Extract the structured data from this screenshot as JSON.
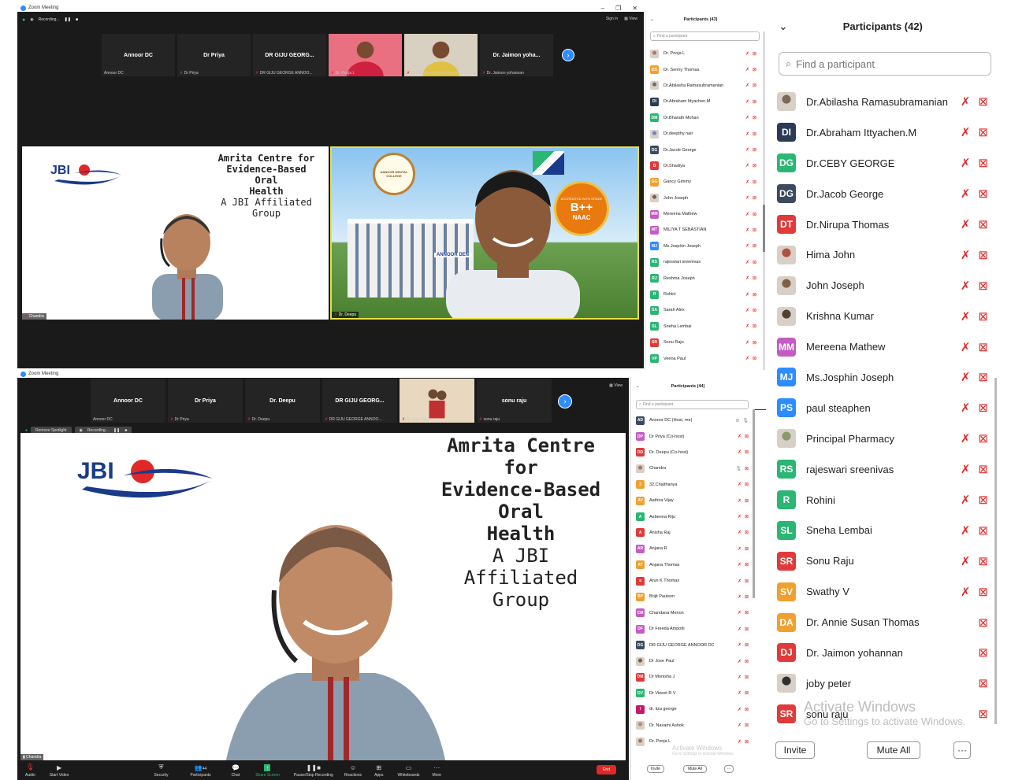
{
  "top_window": {
    "title": "Zoom Meeting",
    "recording": "Recording...",
    "sign_in": "Sign in",
    "view": "View",
    "strip": [
      {
        "name": "Annoor DC",
        "sub": "Annoor DC",
        "type": "name"
      },
      {
        "name": "Dr Priya",
        "sub": "Dr Priya",
        "type": "name"
      },
      {
        "name": "DR GIJU GEORG...",
        "sub": "DR GIJU GEORGE ANNOO...",
        "type": "name"
      },
      {
        "name": "",
        "sub": "Dr. Pooja L",
        "type": "video-woman"
      },
      {
        "name": "",
        "sub": "Dr.Abilasha Ramasubrama...",
        "type": "video-woman2"
      },
      {
        "name": "Dr. Jaimon yoha...",
        "sub": "Dr. Jaimon yohannan",
        "type": "name"
      }
    ],
    "tile_left_label": "Chandra",
    "tile_right_label": "Dr. Deepu",
    "slide": {
      "line1": "Amrita Centre for",
      "line2": "Evidence-Based Oral",
      "line3": "Health",
      "line4": "A JBI Affiliated Group",
      "logo": "JBI"
    },
    "badge": {
      "top": "ACCREDITED WITH GRADE",
      "grade": "B++",
      "bottom": "NAAC"
    },
    "building_sign": "ANNOOR DEN",
    "college_ring": "ANNOOR DENTAL COLLEGE"
  },
  "top_panel": {
    "title": "Participants (43)",
    "search": "Find a participant",
    "rows": [
      {
        "initials": "",
        "name": "Dr. Pooja L",
        "color": "#b07a5a",
        "photo": true
      },
      {
        "initials": "DS",
        "name": "Dr. Senny Thomas",
        "color": "#f0a030"
      },
      {
        "initials": "",
        "name": "Dr.Abilasha Ramasubramanian",
        "color": "#7a6a5a",
        "photo": true
      },
      {
        "initials": "DI",
        "name": "Dr.Abraham Ittyachen.M",
        "color": "#2b3a55"
      },
      {
        "initials": "DM",
        "name": "Dr.Bharath Mohan",
        "color": "#2bb673"
      },
      {
        "initials": "",
        "name": "Dr.deepthy nair",
        "color": "#6a8ac0",
        "photo": true
      },
      {
        "initials": "DG",
        "name": "Dr.Jacob George",
        "color": "#3c4a5e"
      },
      {
        "initials": "D",
        "name": "Dr.Shadiya",
        "color": "#e03a3a"
      },
      {
        "initials": "GG",
        "name": "Gancy Gimmy",
        "color": "#f0a030"
      },
      {
        "initials": "",
        "name": "John Joseph",
        "color": "#806040",
        "photo": true
      },
      {
        "initials": "MM",
        "name": "Mereena Mathew",
        "color": "#c45cc4"
      },
      {
        "initials": "MT",
        "name": "MILIYA T SEBASTIAN",
        "color": "#c45cc4"
      },
      {
        "initials": "MJ",
        "name": "Ms.Josphin Joseph",
        "color": "#2d8cff"
      },
      {
        "initials": "RS",
        "name": "rajeswari sreenivas",
        "color": "#2bb673"
      },
      {
        "initials": "RJ",
        "name": "Reshma Joseph",
        "color": "#2bb673"
      },
      {
        "initials": "R",
        "name": "Rohini",
        "color": "#2bb673"
      },
      {
        "initials": "SA",
        "name": "Sarah Alex",
        "color": "#2bb673"
      },
      {
        "initials": "SL",
        "name": "Sneha Lembai",
        "color": "#2bb673"
      },
      {
        "initials": "SR",
        "name": "Sonu Raju",
        "color": "#e03a3a"
      },
      {
        "initials": "VP",
        "name": "Veena Paul",
        "color": "#2bb673"
      }
    ]
  },
  "bottom_window": {
    "title": "Zoom Meeting",
    "view": "View",
    "remove_spotlight": "Remove Spotlight",
    "recording": "Recording...",
    "strip": [
      {
        "name": "Annoor DC",
        "sub": "Annoor DC",
        "type": "name"
      },
      {
        "name": "Dr Priya",
        "sub": "Dr Priya",
        "type": "name"
      },
      {
        "name": "Dr. Deepu",
        "sub": "Dr. Deepu",
        "type": "name"
      },
      {
        "name": "DR GIJU GEORG...",
        "sub": "DR GIJU GEORGE ANNOO...",
        "type": "name"
      },
      {
        "name": "",
        "sub": "Dr Jose Paul",
        "type": "video-couple"
      },
      {
        "name": "sonu raju",
        "sub": "sonu raju",
        "type": "name"
      }
    ],
    "speaker_label": "Chandra",
    "slide": {
      "line1": "Amrita Centre for",
      "line2": "Evidence-Based Oral",
      "line3": "Health",
      "line4": "A JBI Affiliated Group",
      "logo": "JBI"
    },
    "toolbar": {
      "audio": "Audio",
      "video": "Start Video",
      "security": "Security",
      "participants": "Participants",
      "participants_count": "44",
      "chat": "Chat",
      "share": "Share Screen",
      "record": "Pause/Stop Recording",
      "reactions": "Reactions",
      "apps": "Apps",
      "whiteboards": "Whiteboards",
      "more": "More",
      "end": "End"
    }
  },
  "bottom_panel": {
    "title": "Participants (44)",
    "search": "Find a participant",
    "rows": [
      {
        "initials": "AD",
        "name": "Annoor DC (Host, me)",
        "color": "#3c4a5e",
        "host": true
      },
      {
        "initials": "DP",
        "name": "Dr Priya (Co-host)",
        "color": "#c45cc4"
      },
      {
        "initials": "DD",
        "name": "Dr. Deepu (Co-host)",
        "color": "#e03a3a"
      },
      {
        "initials": "",
        "name": "Chandra",
        "color": "#a08060",
        "photo": true,
        "mic_on": true
      },
      {
        "initials": "3",
        "name": "32.Chaithanya",
        "color": "#f0a030"
      },
      {
        "initials": "AV",
        "name": "Aathira Vijay",
        "color": "#f0a030"
      },
      {
        "initials": "A",
        "name": "Aebeena Riju",
        "color": "#2bb673"
      },
      {
        "initials": "A",
        "name": "Anisha Raj",
        "color": "#e03a3a"
      },
      {
        "initials": "AR",
        "name": "Anjana R",
        "color": "#c45cc4"
      },
      {
        "initials": "AT",
        "name": "Anjana Thomas",
        "color": "#f0a030"
      },
      {
        "initials": "a",
        "name": "Arun K Thomas",
        "color": "#e03a3a"
      },
      {
        "initials": "BP",
        "name": "Brijit Paulson",
        "color": "#f0a030"
      },
      {
        "initials": "CM",
        "name": "Chandana Menon",
        "color": "#c45cc4"
      },
      {
        "initials": "DF",
        "name": "Dr Freeda Ampotti",
        "color": "#c45cc4"
      },
      {
        "initials": "DG",
        "name": "DR GIJU GEORGE ANNOOR DC",
        "color": "#3c4a5e"
      },
      {
        "initials": "",
        "name": "Dr Jose Paul",
        "color": "#806040",
        "photo": true
      },
      {
        "initials": "DM",
        "name": "Dr Monisha J",
        "color": "#e03a3a"
      },
      {
        "initials": "DV",
        "name": "Dr Vineet R V",
        "color": "#2bb673"
      },
      {
        "initials": "l",
        "name": "dr. liza george",
        "color": "#c41a6a"
      },
      {
        "initials": "",
        "name": "Dr. Navami Ashok",
        "color": "#b09070",
        "photo": true
      },
      {
        "initials": "",
        "name": "Dr. Pooja L",
        "color": "#b07a5a",
        "photo": true
      }
    ],
    "watermark": "Activate Windows",
    "watermark_sub": "Go to Settings to activate Windows.",
    "invite": "Invite",
    "mute_all": "Mute All"
  },
  "right_panel": {
    "title": "Participants (42)",
    "search": "Find a participant",
    "rows": [
      {
        "initials": "",
        "name": "Dr.Abilasha Ramasubramanian",
        "color": "#7a6a5a",
        "photo": true,
        "mic": true
      },
      {
        "initials": "DI",
        "name": "Dr.Abraham Ittyachen.M",
        "color": "#2b3a55",
        "mic": true
      },
      {
        "initials": "DG",
        "name": "Dr.CEBY GEORGE",
        "color": "#2bb673",
        "mic": true
      },
      {
        "initials": "DG",
        "name": "Dr.Jacob George",
        "color": "#3c4a5e",
        "mic": true
      },
      {
        "initials": "DT",
        "name": "Dr.Nirupa Thomas",
        "color": "#e03a3a",
        "mic": true
      },
      {
        "initials": "",
        "name": "Hima John",
        "color": "#b05040",
        "photo": true,
        "mic": true
      },
      {
        "initials": "",
        "name": "John Joseph",
        "color": "#806040",
        "photo": true,
        "mic": true
      },
      {
        "initials": "",
        "name": "Krishna Kumar",
        "color": "#504030",
        "photo": true,
        "mic": true
      },
      {
        "initials": "MM",
        "name": "Mereena Mathew",
        "color": "#c45cc4",
        "mic": true
      },
      {
        "initials": "MJ",
        "name": "Ms.Josphin Joseph",
        "color": "#2d8cff",
        "mic": true
      },
      {
        "initials": "PS",
        "name": "paul steaphen",
        "color": "#2d8cff",
        "mic": true
      },
      {
        "initials": "",
        "name": "Principal Pharmacy",
        "color": "#8a9a6a",
        "photo": true,
        "mic": true
      },
      {
        "initials": "RS",
        "name": "rajeswari sreenivas",
        "color": "#2bb673",
        "mic": true
      },
      {
        "initials": "R",
        "name": "Rohini",
        "color": "#2bb673",
        "mic": true
      },
      {
        "initials": "SL",
        "name": "Sneha Lembai",
        "color": "#2bb673",
        "mic": true
      },
      {
        "initials": "SR",
        "name": "Sonu Raju",
        "color": "#e03a3a",
        "mic": true
      },
      {
        "initials": "SV",
        "name": "Swathy  V",
        "color": "#f0a030",
        "mic": true
      },
      {
        "initials": "DA",
        "name": "Dr. Annie Susan Thomas",
        "color": "#f0a030",
        "mic": false
      },
      {
        "initials": "DJ",
        "name": "Dr. Jaimon yohannan",
        "color": "#e03a3a",
        "mic": false
      },
      {
        "initials": "",
        "name": "joby peter",
        "color": "#303030",
        "photo": true,
        "mic": false
      },
      {
        "initials": "SR",
        "name": "sonu raju",
        "color": "#e03a3a",
        "mic": false
      }
    ],
    "watermark": "Activate Windows",
    "watermark_sub": "Go to Settings to activate Windows.",
    "invite": "Invite",
    "mute_all": "Mute All",
    "more": "···"
  }
}
